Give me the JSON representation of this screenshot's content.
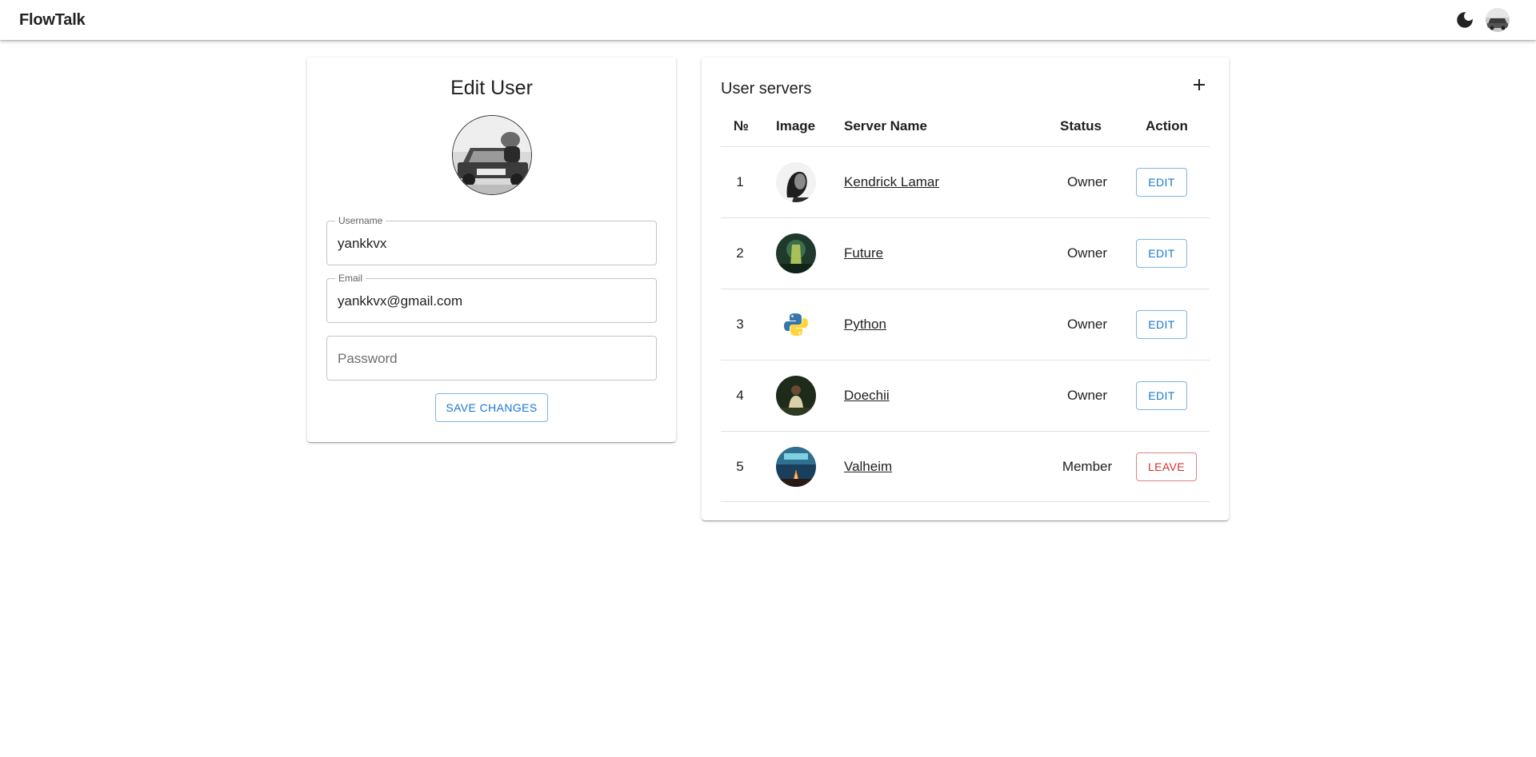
{
  "app": {
    "title": "FlowTalk"
  },
  "header": {
    "theme_icon": "moon-icon",
    "avatar_icon": "user-avatar"
  },
  "edit_user": {
    "title": "Edit User",
    "username": {
      "label": "Username",
      "value": "yankkvx"
    },
    "email": {
      "label": "Email",
      "value": "yankkvx@gmail.com"
    },
    "password": {
      "placeholder": "Password"
    },
    "save_label": "SAVE CHANGES"
  },
  "servers": {
    "title": "User servers",
    "add_icon": "plus-icon",
    "columns": [
      "№",
      "Image",
      "Server Name",
      "Status",
      "Action"
    ],
    "rows": [
      {
        "num": "1",
        "name": "Kendrick Lamar",
        "status": "Owner",
        "action": "EDIT"
      },
      {
        "num": "2",
        "name": "Future",
        "status": "Owner",
        "action": "EDIT"
      },
      {
        "num": "3",
        "name": "Python",
        "status": "Owner",
        "action": "EDIT"
      },
      {
        "num": "4",
        "name": "Doechii",
        "status": "Owner",
        "action": "EDIT"
      },
      {
        "num": "5",
        "name": "Valheim",
        "status": "Member",
        "action": "LEAVE"
      }
    ]
  },
  "colors": {
    "primary": "#1976d2",
    "danger": "#d32f2f",
    "divider": "#e0e0e0"
  }
}
